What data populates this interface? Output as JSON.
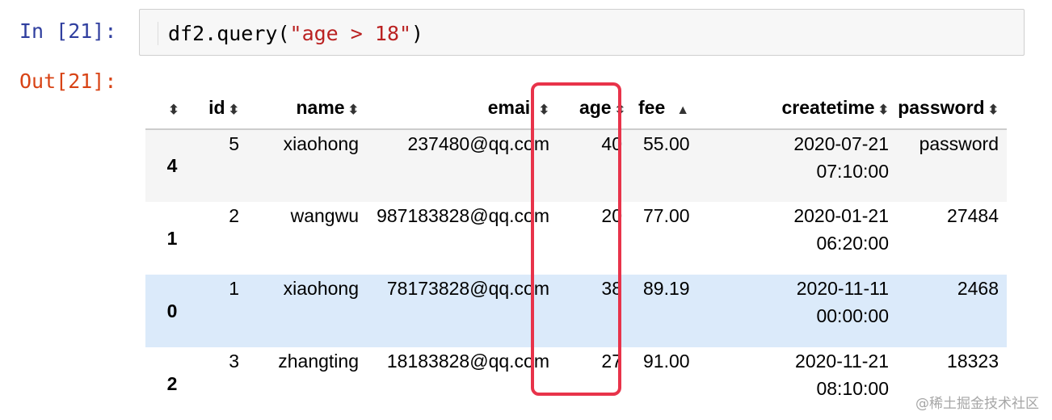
{
  "cell": {
    "in_prompt": "In [21]:",
    "out_prompt": "Out[21]:",
    "code": {
      "fn": "df2.query",
      "open": "(",
      "arg": "\"age > 18\"",
      "close": ")"
    }
  },
  "table": {
    "columns": [
      "id",
      "name",
      "email",
      "age",
      "fee",
      "createtime",
      "password"
    ],
    "sort_icons": {
      "index": "⬍",
      "id": "⬍",
      "name": "⬍",
      "email": "⬍",
      "age": "⬍",
      "fee": "▲",
      "createtime": "⬍",
      "password": "⬍"
    },
    "rows": [
      {
        "index": "4",
        "id": "5",
        "name": "xiaohong",
        "email": "237480@qq.com",
        "age": "40",
        "fee": "55.00",
        "date": "2020-07-21",
        "time": "07:10:00",
        "password": "password"
      },
      {
        "index": "1",
        "id": "2",
        "name": "wangwu",
        "email": "987183828@qq.com",
        "age": "20",
        "fee": "77.00",
        "date": "2020-01-21",
        "time": "06:20:00",
        "password": "27484"
      },
      {
        "index": "0",
        "id": "1",
        "name": "xiaohong",
        "email": "78173828@qq.com",
        "age": "38",
        "fee": "89.19",
        "date": "2020-11-11",
        "time": "00:00:00",
        "password": "2468"
      },
      {
        "index": "2",
        "id": "3",
        "name": "zhangting",
        "email": "18183828@qq.com",
        "age": "27",
        "fee": "91.00",
        "date": "2020-11-21",
        "time": "08:10:00",
        "password": "18323"
      }
    ]
  },
  "colors": {
    "highlight_box": "#e8334a",
    "selected_row": "#dbeafa",
    "in_prompt": "#303f9f",
    "out_prompt": "#d84315"
  },
  "watermark": "@稀土掘金技术社区"
}
